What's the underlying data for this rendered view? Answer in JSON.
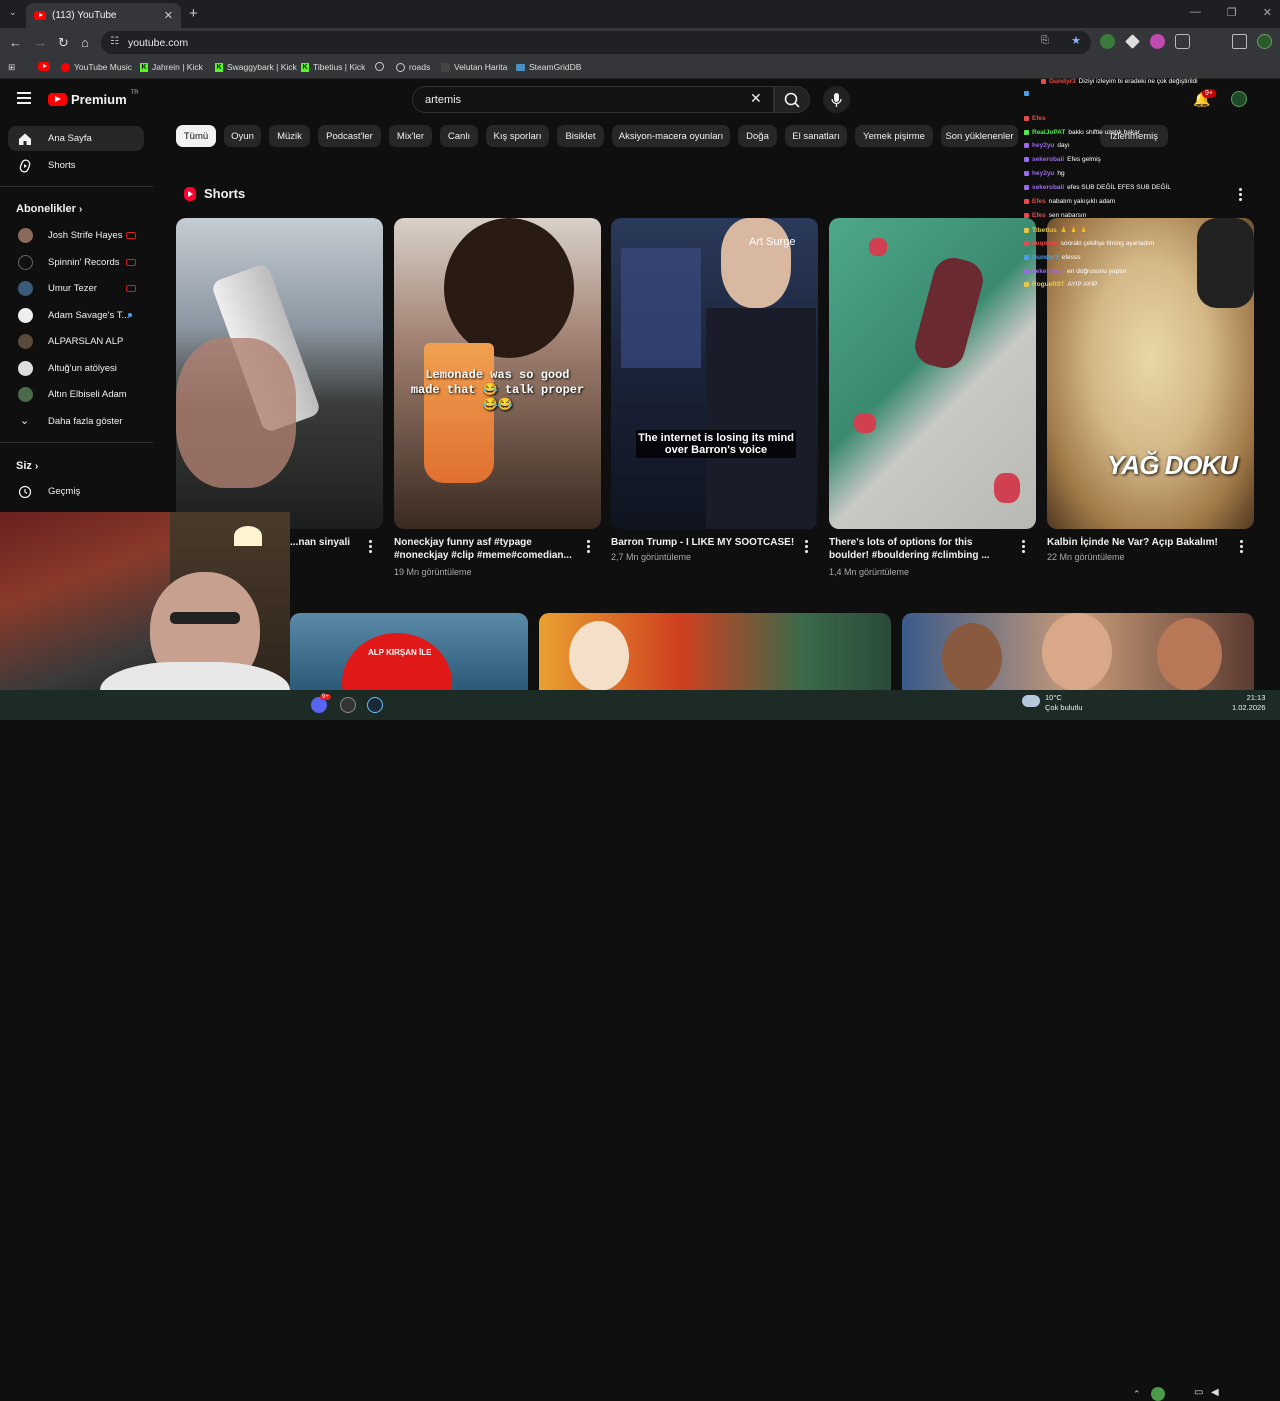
{
  "browser": {
    "tab_title": "(113) YouTube",
    "url": "youtube.com",
    "bookmarks": [
      "YouTube Music",
      "Jahrein | Kick",
      "Swaggybark | Kick",
      "Tibetius | Kick",
      "roads",
      "Velutan Harita",
      "SteamGridDB"
    ]
  },
  "header": {
    "logo": "Premium",
    "logo_region": "TR",
    "search_value": "artemis",
    "notifications_badge": "9+"
  },
  "sidebar": {
    "items": [
      {
        "label": "Ana Sayfa",
        "icon": "home-icon"
      },
      {
        "label": "Shorts",
        "icon": "shorts-icon"
      }
    ],
    "subscriptions_heading": "Abonelikler",
    "subscriptions": [
      {
        "label": "Josh Strife Hayes",
        "live": true,
        "color": "#8a6a5a"
      },
      {
        "label": "Spinnin' Records",
        "live": true,
        "color": "#111111"
      },
      {
        "label": "Umur Tezer",
        "live": true,
        "color": "#3a5a7a"
      },
      {
        "label": "Adam Savage's T...",
        "live": false,
        "color": "#eeeeee"
      },
      {
        "label": "ALPARSLAN ALP",
        "live": false,
        "color": "#5a4a3a"
      },
      {
        "label": "Altuğ'un atölyesi",
        "live": false,
        "color": "#dddddd"
      },
      {
        "label": "Altın Elbiseli Adam",
        "live": false,
        "color": "#4a6a4a"
      }
    ],
    "show_more": "Daha fazla göster",
    "you_heading": "Siz",
    "history": "Geçmiş"
  },
  "chips": [
    "Tümü",
    "Oyun",
    "Müzik",
    "Podcast'ler",
    "Mix'ler",
    "Canlı",
    "Kış sporları",
    "Bisiklet",
    "Aksiyon-macera oyunları",
    "Doğa",
    "El sanatları",
    "Yemek pişirme",
    "Son yüklenenler",
    "İzlenmemiş"
  ],
  "shorts": {
    "heading": "Shorts",
    "items": [
      {
        "title": "...nan sinyali",
        "views": "",
        "overlay": ""
      },
      {
        "title": "Noneckjay funny asf #typage #noneckjay #clip #meme#comedian...",
        "views": "19 Mn görüntüleme",
        "overlay": "Lemonade was so good made that 😂 talk proper😂😂"
      },
      {
        "title": "Barron Trump - I LIKE MY SOOTCASE!",
        "views": "2,7 Mn görüntüleme",
        "overlay": "The internet is losing its mind over Barron's voice",
        "watermark": "Art Surge"
      },
      {
        "title": "There's lots of options for this boulder! #bouldering #climbing ...",
        "views": "1,4 Mn görüntüleme",
        "overlay": ""
      },
      {
        "title": "Kalbin İçinde Ne Var? Açıp Bakalım!",
        "views": "22 Mn görüntüleme",
        "overlay": "YAĞ DOKU"
      }
    ]
  },
  "bottom_thumb_text": "ALP KIRŞAN İLE",
  "chat": {
    "messages": [
      {
        "user": "Gundyr3",
        "text": "Diziyi izleyim bi eradeki ne çok değiştirildi",
        "color": "#e84a4a"
      },
      {
        "user": "",
        "text": "",
        "color": "#4aa0e8"
      },
      {
        "user": "Efes",
        "text": "",
        "color": "#e84a4a"
      },
      {
        "user": "RealJoPAT",
        "text": "bakkı shiftle uzatık bakar",
        "color": "#57e84a"
      },
      {
        "user": "hey2yu",
        "text": "dayı",
        "color": "#9a6ae8"
      },
      {
        "user": "sekerobali",
        "text": "Efes gelmiş",
        "color": "#9a6ae8"
      },
      {
        "user": "hey2yu",
        "text": "hg",
        "color": "#9a6ae8"
      },
      {
        "user": "sekerobali",
        "text": "efes SUB DEĞİL EFES SUB DEĞİL",
        "color": "#9a6ae8"
      },
      {
        "user": "Efes",
        "text": "nabalım yakışıklı adam",
        "color": "#e84a4a"
      },
      {
        "user": "Efes",
        "text": "sen nabarsın",
        "color": "#e84a4a"
      },
      {
        "user": "Tibetius",
        "text": "🙏 🙏 🙏",
        "color": "#e8c84a"
      },
      {
        "user": "kuqoran",
        "text": "sonraki çekilişe timing ayarladım",
        "color": "#e84a4a"
      },
      {
        "user": "Gundyr3",
        "text": "efesss",
        "color": "#4aa0e8"
      },
      {
        "user": "sekerobali",
        "text": "en doğrusunu yaptın",
        "color": "#9a6ae8"
      },
      {
        "user": "RogueR9T",
        "text": "AYIP AYIP",
        "color": "#e8c84a"
      }
    ]
  },
  "taskbar": {
    "temperature": "10°C",
    "weather": "Çok bulutlu",
    "time": "21:13",
    "date": "1.02.2026",
    "badge": "9+"
  },
  "colors": {
    "accent": "#ff0000",
    "chip_bg": "#272727",
    "background": "#0f0f0f"
  }
}
